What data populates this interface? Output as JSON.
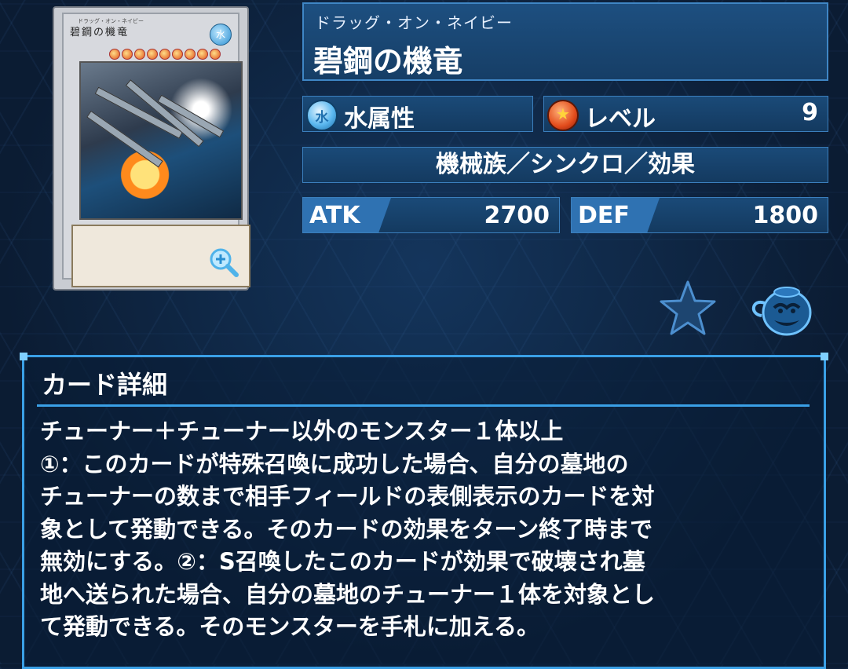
{
  "card": {
    "ruby": "ドラッグ・オン・ネイビー",
    "name": "碧鋼の機竜",
    "card_image_name": "碧鋼の機竜",
    "card_image_ruby": "ドラッグ・オン・ネイビー",
    "card_image_attribute_glyph": "水",
    "attribute_label": "水属性",
    "attribute_icon": "water-attribute-icon",
    "level_label": "レベル",
    "level_value": "9",
    "level_icon": "level-star-icon",
    "type_line": "機械族／シンクロ／効果",
    "atk_label": "ATK",
    "atk_value": "2700",
    "def_label": "DEF",
    "def_value": "1800"
  },
  "actions": {
    "zoom_icon": "magnifier-plus-icon",
    "favorite_icon": "star-icon",
    "deck_icon": "pot-of-greed-icon"
  },
  "detail": {
    "title": "カード詳細",
    "lines": [
      "チューナー＋チューナー以外のモンスター１体以上",
      "①：このカードが特殊召喚に成功した場合、自分の墓地の",
      "チューナーの数まで相手フィールドの表側表示のカードを対",
      "象として発動できる。そのカードの効果をターン終了時まで",
      "無効にする。②：S召喚したこのカードが効果で破壊され墓",
      "地へ送られた場合、自分の墓地のチューナー１体を対象とし",
      "て発動できる。そのモンスターを手札に加える。"
    ]
  },
  "colors": {
    "background": "#0b1c33",
    "panel": "#1a4a78",
    "border": "#3b7fbd",
    "accent": "#3aa0e6",
    "stat_tag": "#2f72b2"
  }
}
